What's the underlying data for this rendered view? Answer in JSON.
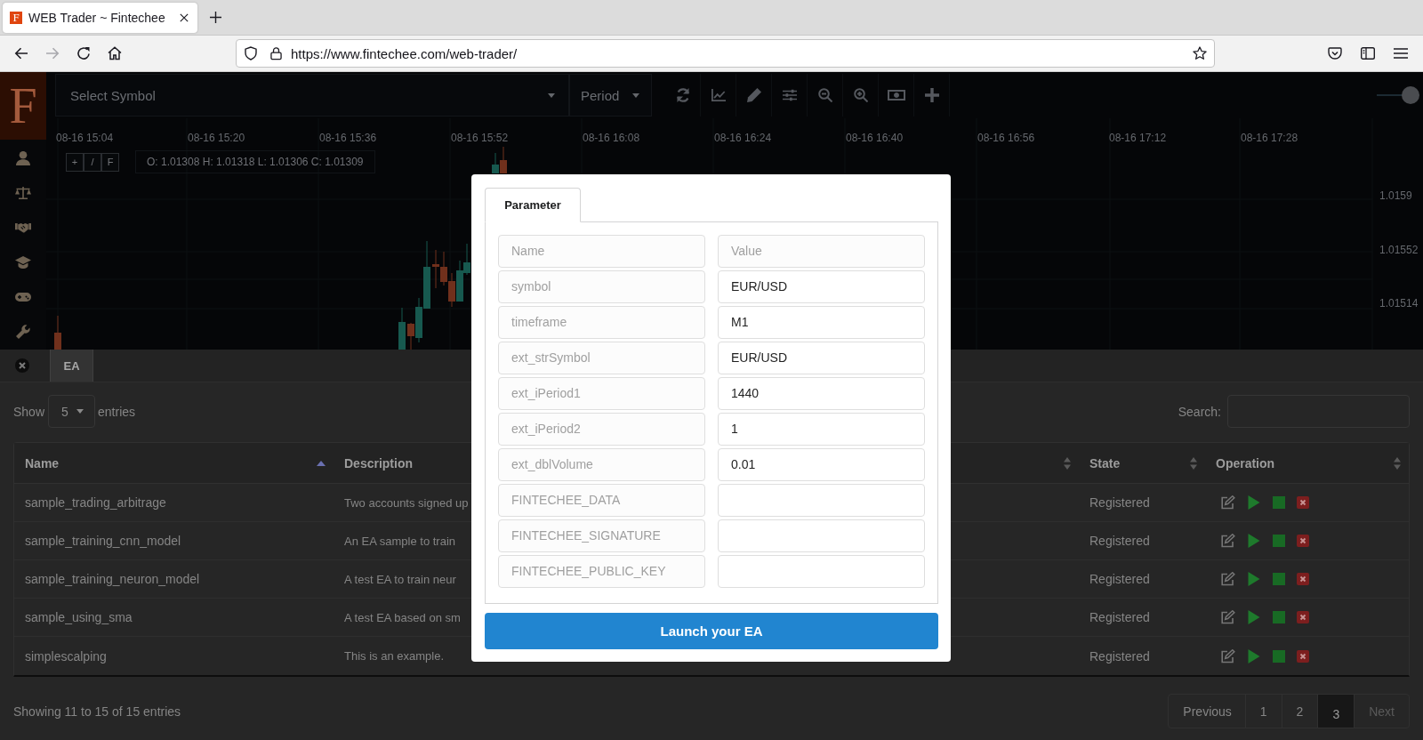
{
  "browser": {
    "tabs": [
      {
        "icon_letter": "F",
        "title": "WEB Trader ~ Fintechee",
        "selected": true
      }
    ],
    "forward": {
      "disabled": true
    },
    "url": "https://www.fintechee.com/web-trader/"
  },
  "app": {
    "logo": "F",
    "symbol_select": {
      "placeholder": "Select Symbol"
    },
    "period_select": {
      "placeholder": "Period"
    },
    "zoom_slider": {
      "level": 1
    },
    "chart": {
      "time_labels": [
        "08-16 15:04",
        "08-16 15:20",
        "08-16 15:36",
        "08-16 15:52",
        "08-16 16:08",
        "08-16 16:24",
        "08-16 16:40",
        "08-16 16:56",
        "08-16 17:12",
        "08-16 17:28"
      ],
      "tool_buttons": [
        "+",
        "/",
        "F"
      ],
      "ohlc": "O: 1.01308 H: 1.01318 L: 1.01306 C: 1.01309",
      "price_labels": [
        "1.0159",
        "1.01552",
        "1.01514"
      ]
    },
    "panel": {
      "tabs": [
        {
          "label": "EA",
          "selected": true
        }
      ],
      "length_menu": {
        "before": "Show",
        "value": "5",
        "after": "entries"
      },
      "search": {
        "label": "Search:"
      },
      "table": {
        "columns": [
          {
            "label": "Name",
            "sorted": true
          },
          {
            "label": "Description"
          },
          {
            "sorted": false
          },
          {
            "label": "State",
            "sorted": false
          },
          {
            "label": "Operation",
            "sorted": false
          }
        ],
        "rows": [
          {
            "name": "sample_trading_arbitrage",
            "description": "Two accounts signed up",
            "state": "Registered"
          },
          {
            "name": "sample_training_cnn_model",
            "description": "An EA sample to train",
            "state": "Registered"
          },
          {
            "name": "sample_training_neuron_model",
            "description": "A test EA to train neur",
            "state": "Registered"
          },
          {
            "name": "sample_using_sma",
            "description": "A test EA based on sm",
            "state": "Registered"
          },
          {
            "name": "simplescalping",
            "description": "This is an example.",
            "state": "Registered"
          }
        ]
      },
      "info": "Showing 11 to 15 of 15 entries",
      "pagination": [
        {
          "label": "Previous",
          "selected": false,
          "disabled": false
        },
        {
          "label": "1",
          "selected": false,
          "disabled": false
        },
        {
          "label": "2",
          "selected": false,
          "disabled": false
        },
        {
          "label": "3",
          "selected": true,
          "disabled": false
        },
        {
          "label": "Next",
          "selected": false,
          "disabled": true
        }
      ]
    }
  },
  "modal": {
    "tabs": [
      {
        "label": "Parameter",
        "selected": true
      }
    ],
    "header": {
      "name": "Name",
      "value": "Value"
    },
    "parameters": [
      {
        "name": "symbol",
        "value": "EUR/USD"
      },
      {
        "name": "timeframe",
        "value": "M1"
      },
      {
        "name": "ext_strSymbol",
        "value": "EUR/USD"
      },
      {
        "name": "ext_iPeriod1",
        "value": "1440"
      },
      {
        "name": "ext_iPeriod2",
        "value": "1"
      },
      {
        "name": "ext_dblVolume",
        "value": "0.01"
      },
      {
        "name": "FINTECHEE_DATA"
      },
      {
        "name": "FINTECHEE_SIGNATURE"
      },
      {
        "name": "FINTECHEE_PUBLIC_KEY"
      }
    ],
    "submit": "Launch your EA"
  }
}
